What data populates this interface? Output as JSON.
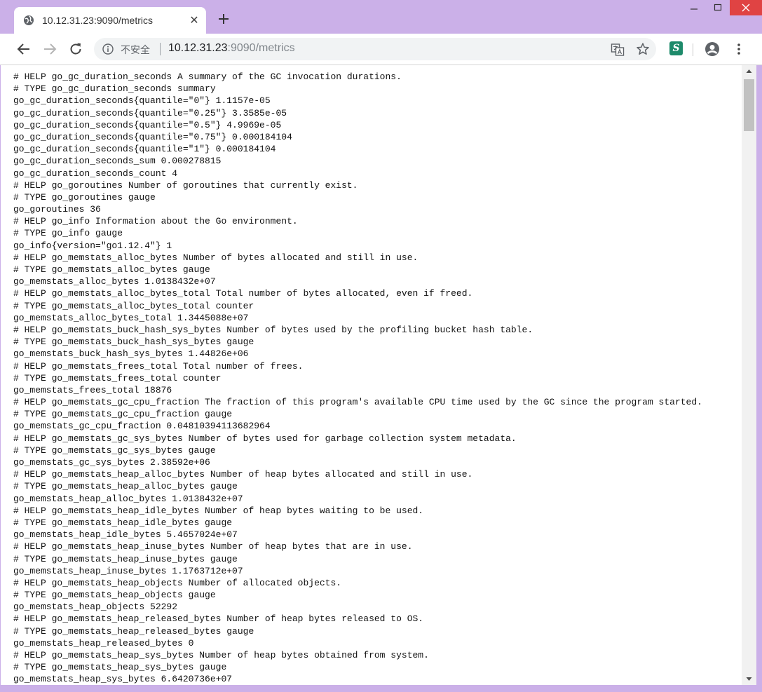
{
  "tab": {
    "title": "10.12.31.23:9090/metrics",
    "favicon": "globe-icon",
    "close_glyph": "✕",
    "new_tab_icon": "plus-icon"
  },
  "window_controls": {
    "minimize_icon": "minimize-icon",
    "maximize_icon": "maximize-icon",
    "close_icon": "close-icon",
    "close_color": "#e04343"
  },
  "toolbar": {
    "back_icon": "back-arrow-icon",
    "forward_icon": "forward-arrow-icon",
    "reload_icon": "reload-icon",
    "security_label": "不安全",
    "url_host": "10.12.31.23",
    "url_rest": ":9090/metrics",
    "translate_icon": "translate-icon",
    "bookmark_icon": "star-icon",
    "extension_label": "S",
    "extension_color": "#1d8a6a",
    "profile_icon": "account-icon",
    "menu_icon": "kebab-menu-icon"
  },
  "metrics_lines": [
    "# HELP go_gc_duration_seconds A summary of the GC invocation durations.",
    "# TYPE go_gc_duration_seconds summary",
    "go_gc_duration_seconds{quantile=\"0\"} 1.1157e-05",
    "go_gc_duration_seconds{quantile=\"0.25\"} 3.3585e-05",
    "go_gc_duration_seconds{quantile=\"0.5\"} 4.9969e-05",
    "go_gc_duration_seconds{quantile=\"0.75\"} 0.000184104",
    "go_gc_duration_seconds{quantile=\"1\"} 0.000184104",
    "go_gc_duration_seconds_sum 0.000278815",
    "go_gc_duration_seconds_count 4",
    "# HELP go_goroutines Number of goroutines that currently exist.",
    "# TYPE go_goroutines gauge",
    "go_goroutines 36",
    "# HELP go_info Information about the Go environment.",
    "# TYPE go_info gauge",
    "go_info{version=\"go1.12.4\"} 1",
    "# HELP go_memstats_alloc_bytes Number of bytes allocated and still in use.",
    "# TYPE go_memstats_alloc_bytes gauge",
    "go_memstats_alloc_bytes 1.0138432e+07",
    "# HELP go_memstats_alloc_bytes_total Total number of bytes allocated, even if freed.",
    "# TYPE go_memstats_alloc_bytes_total counter",
    "go_memstats_alloc_bytes_total 1.3445088e+07",
    "# HELP go_memstats_buck_hash_sys_bytes Number of bytes used by the profiling bucket hash table.",
    "# TYPE go_memstats_buck_hash_sys_bytes gauge",
    "go_memstats_buck_hash_sys_bytes 1.44826e+06",
    "# HELP go_memstats_frees_total Total number of frees.",
    "# TYPE go_memstats_frees_total counter",
    "go_memstats_frees_total 18876",
    "# HELP go_memstats_gc_cpu_fraction The fraction of this program's available CPU time used by the GC since the program started.",
    "# TYPE go_memstats_gc_cpu_fraction gauge",
    "go_memstats_gc_cpu_fraction 0.04810394113682964",
    "# HELP go_memstats_gc_sys_bytes Number of bytes used for garbage collection system metadata.",
    "# TYPE go_memstats_gc_sys_bytes gauge",
    "go_memstats_gc_sys_bytes 2.38592e+06",
    "# HELP go_memstats_heap_alloc_bytes Number of heap bytes allocated and still in use.",
    "# TYPE go_memstats_heap_alloc_bytes gauge",
    "go_memstats_heap_alloc_bytes 1.0138432e+07",
    "# HELP go_memstats_heap_idle_bytes Number of heap bytes waiting to be used.",
    "# TYPE go_memstats_heap_idle_bytes gauge",
    "go_memstats_heap_idle_bytes 5.4657024e+07",
    "# HELP go_memstats_heap_inuse_bytes Number of heap bytes that are in use.",
    "# TYPE go_memstats_heap_inuse_bytes gauge",
    "go_memstats_heap_inuse_bytes 1.1763712e+07",
    "# HELP go_memstats_heap_objects Number of allocated objects.",
    "# TYPE go_memstats_heap_objects gauge",
    "go_memstats_heap_objects 52292",
    "# HELP go_memstats_heap_released_bytes Number of heap bytes released to OS.",
    "# TYPE go_memstats_heap_released_bytes gauge",
    "go_memstats_heap_released_bytes 0",
    "# HELP go_memstats_heap_sys_bytes Number of heap bytes obtained from system.",
    "# TYPE go_memstats_heap_sys_bytes gauge",
    "go_memstats_heap_sys_bytes 6.6420736e+07"
  ],
  "scrollbar": {
    "up_icon": "scroll-up-arrow-icon",
    "down_icon": "scroll-down-arrow-icon"
  }
}
